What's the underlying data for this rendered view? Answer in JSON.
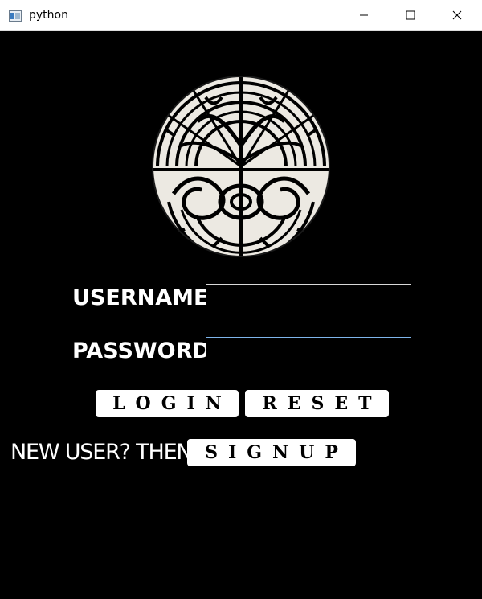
{
  "window": {
    "title": "python",
    "icon": "window-app-icon",
    "controls": [
      "minimize-icon",
      "maximize-icon",
      "close-icon"
    ]
  },
  "emblem": {
    "icon": "celtic-knot-emblem"
  },
  "form": {
    "username_label": "USERNAME",
    "password_label": "PASSWORD",
    "username_value": "",
    "password_value": ""
  },
  "buttons": {
    "login": "LOGIN",
    "reset": "RESET",
    "signup": "SIGNUP"
  },
  "signup_prompt": "NEW USER? THEN",
  "colors": {
    "background": "#000000",
    "titlebar": "#ffffff",
    "focus_border": "#7eb4ea"
  }
}
